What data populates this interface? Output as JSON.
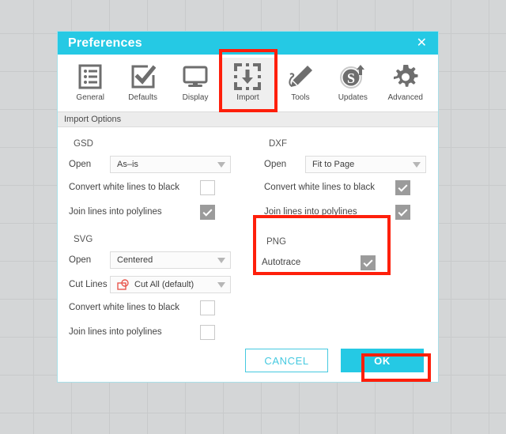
{
  "dialog": {
    "title": "Preferences",
    "close_icon": "close-icon",
    "options_strip_label": "Import Options"
  },
  "toolbar": {
    "items": [
      {
        "label": "General",
        "icon": "list-icon",
        "active": false
      },
      {
        "label": "Defaults",
        "icon": "checkbox-check-icon",
        "active": false
      },
      {
        "label": "Display",
        "icon": "monitor-icon",
        "active": false
      },
      {
        "label": "Import",
        "icon": "import-arrow-icon",
        "active": true
      },
      {
        "label": "Tools",
        "icon": "pencil-icon",
        "active": false
      },
      {
        "label": "Updates",
        "icon": "s-upload-icon",
        "active": false
      },
      {
        "label": "Advanced",
        "icon": "gear-icon",
        "active": false
      }
    ]
  },
  "sections": {
    "gsd": {
      "title": "GSD",
      "open_label": "Open",
      "open_value": "As–is",
      "convert_label": "Convert white lines to black",
      "convert_checked": false,
      "join_label": "Join lines into polylines",
      "join_checked": true
    },
    "dxf": {
      "title": "DXF",
      "open_label": "Open",
      "open_value": "Fit to Page",
      "convert_label": "Convert white lines to black",
      "convert_checked": true,
      "join_label": "Join lines into polylines",
      "join_checked": true
    },
    "svg": {
      "title": "SVG",
      "open_label": "Open",
      "open_value": "Centered",
      "cut_label": "Cut Lines",
      "cut_value": "Cut All (default)",
      "cut_icon": "cut-lines-icon",
      "convert_label": "Convert white lines to black",
      "convert_checked": false,
      "join_label": "Join lines into polylines",
      "join_checked": false
    },
    "png": {
      "title": "PNG",
      "autotrace_label": "Autotrace",
      "autotrace_checked": true
    }
  },
  "footer": {
    "cancel_label": "CANCEL",
    "ok_label": "OK"
  },
  "annotations": {
    "highlight_color": "#fe1f0b",
    "boxes": [
      "import-tab",
      "png-panel",
      "ok-button"
    ]
  },
  "colors": {
    "accent": "#25c9e4",
    "accent_border": "#45c9e0",
    "checkbox_checked": "#9b9b9b",
    "cut_icon_red": "#e8584f",
    "canvas_grid": "#c8cacb"
  }
}
